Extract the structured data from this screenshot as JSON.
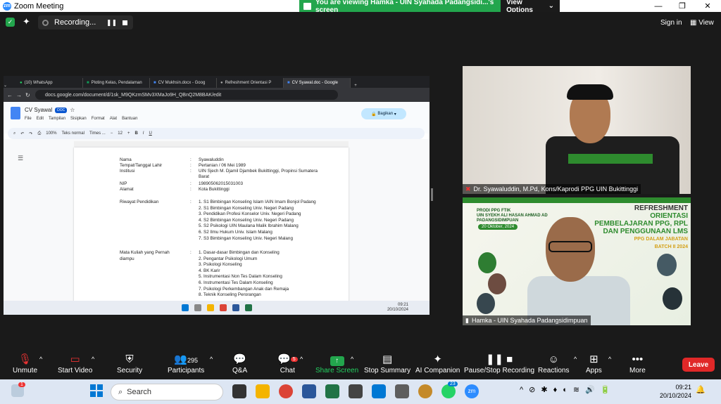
{
  "window": {
    "title": "Zoom Meeting",
    "sign_in": "Sign in",
    "view": "View"
  },
  "banner": {
    "text": "You are viewing Hamka - UIN Syahada Padangsidi...'s screen",
    "view_options": "View Options"
  },
  "recording": {
    "label": "Recording..."
  },
  "browser": {
    "tabs": [
      "(10) WhatsApp",
      "Ploting Kelas, Pendalaman",
      "CV Mukhsin.docx - Goog",
      "Refreshment Orientasi P",
      "CV Syawal.doc - Google"
    ],
    "url": "docs.google.com/document/d/1sk_M9QKzmSMv3XMaJo9H_QBnQ2M8BAK/edit"
  },
  "doc": {
    "title": "CV Syawal",
    "badge": "DOC",
    "menu": [
      "File",
      "Edit",
      "Tampilan",
      "Sisipkan",
      "Format",
      "Alat",
      "Bantuan"
    ],
    "share": "Bagikan",
    "toolbar": {
      "zoom": "100%",
      "style": "Teks normal",
      "font": "Times ...",
      "size": "12"
    },
    "rows": [
      {
        "label": "Nama",
        "value": "Syawaluddin"
      },
      {
        "label": "Tempat/Tanggal Lahir",
        "value": "Pertanian / 06 Mei 1989"
      },
      {
        "label": "Institusi",
        "value": "UIN Sjech M. Djamil Djambek Bukittinggi, Propinsi Sumatera"
      },
      {
        "label": "",
        "value": "Barat"
      },
      {
        "label": "NIP",
        "value": "198905062015031003"
      },
      {
        "label": "Alamat",
        "value": "Kota Bukittinggi"
      }
    ],
    "riwayat_label": "Riwayat Pendidikan",
    "riwayat": [
      "1.   S1 Bimbingan Konseling Islam IAIN Imam Bonjol Padang",
      "2.   S1 Bimbingan Konseling Univ. Negeri Padang",
      "3.   Pendidikan Profesi Konselor Univ. Negeri Padang",
      "4.   S2 Bimbingan Konseling Univ. Negeri Padang",
      "5.   S2 Psikologi UIN Maulana Malik Ibrahim Malang",
      "6.   S2 Ilmu Hukum Univ. Islam Malang",
      "7.   S3 Bimbingan Konseling Univ. Negeri Malang"
    ],
    "matkul_label": "Mata   Kuliah   yang   Pernah",
    "matkul_label2": "diampu",
    "matkul": [
      "1.   Dasar-dasar Bimbingan dan Konseling",
      "2.   Pengantar Psikologi Umum",
      "3.   Psikologi Konseling",
      "4.   BK Karir",
      "5.   Instrumentasi Non Tes Dalam Konseling",
      "6.   Instrumentasi Tes Dalam Konseling",
      "7.   Psikologi Perkembangan Anak dan Remaja",
      "8.   Teknik Konseling Perorangan"
    ],
    "inner_time": "09:21",
    "inner_date": "20/10/2024"
  },
  "participants": [
    {
      "name": "Dr. Syawaluddin, M.Pd, Kons/Kaprodi PPG UIN Bukittinggi"
    },
    {
      "name": "Hamka - UIN Syahada Padangsidimpuan"
    }
  ],
  "poster": {
    "org": "PRODI PPG FTIK",
    "org2": "UIN SYEKH ALI HASAN AHMAD AD",
    "org3": "PADANGSIDIMPUAN",
    "date": "20 Oktober, 2024",
    "title1": "REFRESHMENT",
    "title2": "ORIENTASI",
    "title3": "PEMBELAJARAN PPG, RPL",
    "title4": "DAN PENGGUNAAN LMS",
    "title5": "PPG DALAM JABATAN",
    "title6": "BATCH II 2024"
  },
  "controls": {
    "unmute": "Unmute",
    "start_video": "Start Video",
    "security": "Security",
    "participants": "Participants",
    "participants_count": "295",
    "qa": "Q&A",
    "chat": "Chat",
    "chat_badge": "5",
    "share_screen": "Share Screen",
    "stop_summary": "Stop Summary",
    "ai_companion": "AI Companion",
    "pause_rec": "Pause/Stop Recording",
    "reactions": "Reactions",
    "apps": "Apps",
    "more": "More",
    "leave": "Leave"
  },
  "taskbar": {
    "search": "Search",
    "time": "09:21",
    "date": "20/10/2024",
    "notify_badge": "1",
    "wa_badge": "23"
  },
  "colors": {
    "zoom_blue": "#2d8cff",
    "green": "#23a64d",
    "leave_red": "#e02828"
  }
}
